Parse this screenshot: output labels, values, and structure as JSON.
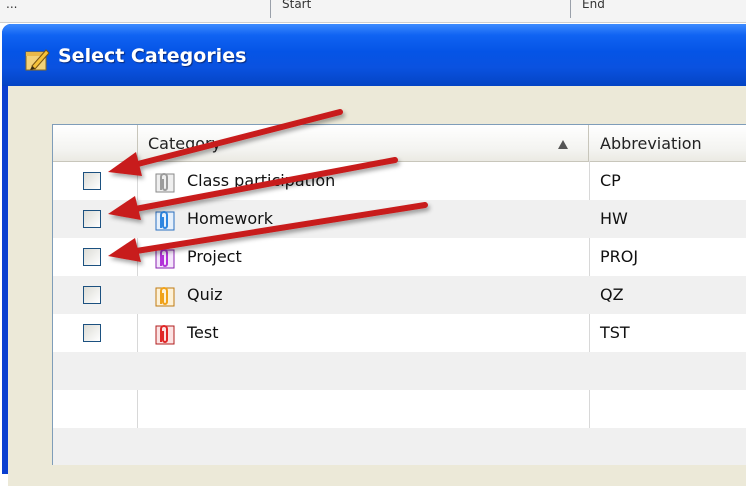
{
  "background_window": {
    "columns": [
      "...",
      "Start",
      "End"
    ]
  },
  "dialog": {
    "title": "Select Categories"
  },
  "table": {
    "headers": {
      "checkbox": "",
      "category": "Category",
      "abbreviation": "Abbreviation"
    },
    "sort": {
      "column": "Category",
      "direction": "ascending"
    },
    "rows": [
      {
        "checked": false,
        "category": "Class participation",
        "abbreviation": "CP",
        "icon": "gray-paperclip-icon",
        "icon_color": "#9c9c9c"
      },
      {
        "checked": false,
        "category": "Homework",
        "abbreviation": "HW",
        "icon": "blue-paperclip-icon",
        "icon_color": "#2f86e0"
      },
      {
        "checked": false,
        "category": "Project",
        "abbreviation": "PROJ",
        "icon": "purple-paperclip-icon",
        "icon_color": "#b232d8"
      },
      {
        "checked": false,
        "category": "Quiz",
        "abbreviation": "QZ",
        "icon": "orange-paperclip-icon",
        "icon_color": "#f0a21a"
      },
      {
        "checked": false,
        "category": "Test",
        "abbreviation": "TST",
        "icon": "red-paperclip-icon",
        "icon_color": "#e02828"
      }
    ]
  },
  "annotation": {
    "arrow_color": "#c81a1a",
    "arrow_count": 3
  }
}
